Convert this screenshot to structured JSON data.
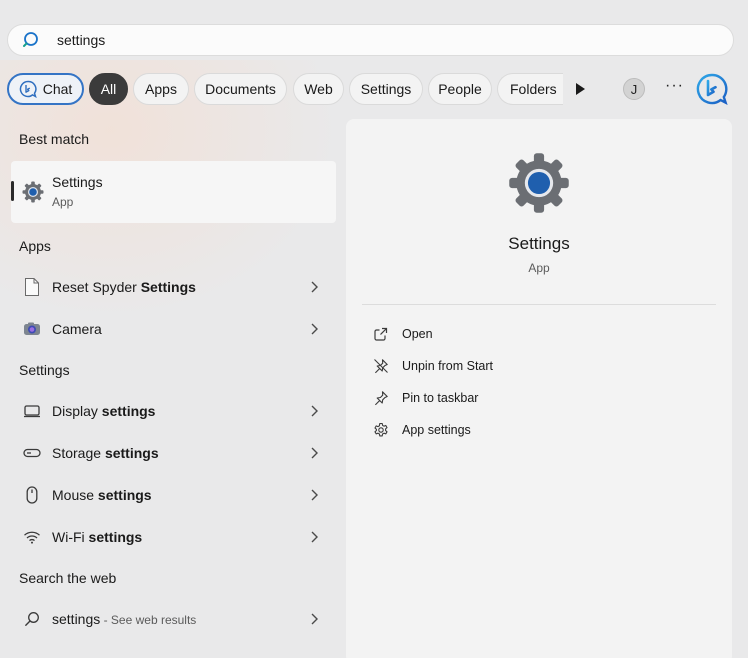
{
  "search": {
    "value": "settings"
  },
  "filters": {
    "chat": "Chat",
    "all": "All",
    "apps": "Apps",
    "documents": "Documents",
    "web": "Web",
    "settings": "Settings",
    "people": "People",
    "folders": "Folders",
    "avatar_initial": "J",
    "more": "···"
  },
  "best_match": {
    "heading": "Best match",
    "name": "Settings",
    "type": "App"
  },
  "apps": {
    "heading": "Apps",
    "items": [
      {
        "prefix": "Reset Spyder ",
        "bold": "Settings",
        "icon": "document-icon"
      },
      {
        "prefix": "Camera",
        "bold": "",
        "icon": "camera-icon"
      }
    ]
  },
  "settings_section": {
    "heading": "Settings",
    "items": [
      {
        "prefix": "Display ",
        "bold": "settings",
        "icon": "monitor-icon"
      },
      {
        "prefix": "Storage ",
        "bold": "settings",
        "icon": "storage-icon"
      },
      {
        "prefix": "Mouse ",
        "bold": "settings",
        "icon": "mouse-icon"
      },
      {
        "prefix": "Wi-Fi ",
        "bold": "settings",
        "icon": "wifi-icon"
      }
    ]
  },
  "web": {
    "heading": "Search the web",
    "query": "settings",
    "hint": " - See web results"
  },
  "detail": {
    "title": "Settings",
    "type": "App",
    "actions": {
      "open": "Open",
      "unpin": "Unpin from Start",
      "pin_taskbar": "Pin to taskbar",
      "app_settings": "App settings"
    }
  },
  "colors": {
    "accent_blue": "#3474c5",
    "gear_gray": "#6b6e73",
    "gear_center": "#1f5fae"
  }
}
